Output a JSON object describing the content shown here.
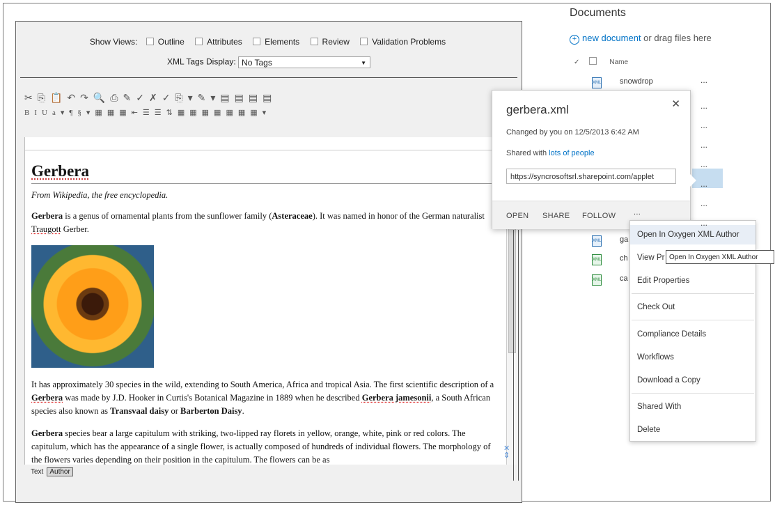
{
  "editor": {
    "show_views_label": "Show Views:",
    "view_options": [
      "Outline",
      "Attributes",
      "Elements",
      "Review",
      "Validation Problems"
    ],
    "xml_tags_label": "XML Tags Display:",
    "xml_tags_value": "No Tags",
    "toolbar_row1": [
      "✂",
      "⎘",
      "📋",
      "↶",
      "↷",
      "🔍",
      "⎙",
      "✎",
      "✓",
      "✗",
      "✓",
      "⎘",
      "▾",
      "✎",
      "▾",
      "▤",
      "▤",
      "▤",
      "▤"
    ],
    "toolbar_row2": [
      "B",
      "I",
      "U",
      "a",
      "▾",
      "¶",
      "§",
      "▾",
      "▦",
      "▦",
      "▦",
      "⇤",
      "☰",
      "☰",
      "⇅",
      "▦",
      "▦",
      "▦",
      "▦",
      "▦",
      "▦",
      "▦",
      "▾"
    ],
    "document": {
      "title": "Gerbera",
      "subtitle": "From Wikipedia, the free encyclopedia.",
      "p1_bold": "Gerbera",
      "p1_a": " is a genus of ornamental plants from the sunflower family (",
      "p1_bold2": "Asteraceae",
      "p1_b": "). It was named in honor of the German naturalist ",
      "p1_name": "Traugott",
      "p1_c": " Gerber.",
      "p2_a": "It has approximately 30 species in the wild, extending to South America, Africa and tropical Asia. The first scientific description of a ",
      "p2_bold": "Gerbera",
      "p2_b": " was made by J.D. Hooker in Curtis's Botanical Magazine in 1889 when he described ",
      "p2_bold2": "Gerbera jamesonii",
      "p2_c": ", a South African species also known as ",
      "p2_bold3": "Transvaal daisy",
      "p2_d": " or ",
      "p2_bold4": "Barberton Daisy",
      "p2_e": ".",
      "p3_bold": "Gerbera",
      "p3_a": " species bear a large capitulum with striking, two-lipped ray florets in yellow, orange, white, pink or red colors. The capitulum, which has the appearance of a single flower, is actually composed of hundreds of individual flowers. The morphology of the flowers varies depending on their position in the capitulum. The flowers can be as"
    },
    "bottom_tabs": [
      "Text",
      "Author"
    ]
  },
  "library": {
    "title": "Documents",
    "new_document_link": "new document",
    "drag_text": " or drag files here",
    "column_name": "Name",
    "check_glyph": "✓",
    "rows": [
      {
        "name": "snowdrop",
        "icon": "xml-file-icon",
        "color": "blue"
      },
      {
        "name": "",
        "icon": "",
        "color": ""
      },
      {
        "name": "",
        "icon": "",
        "color": ""
      },
      {
        "name": "",
        "icon": "",
        "color": ""
      },
      {
        "name": "",
        "icon": "",
        "color": ""
      },
      {
        "name": "",
        "icon": "",
        "color": ""
      },
      {
        "name": "",
        "icon": "",
        "color": ""
      },
      {
        "name": "ga",
        "icon": "xml-file-icon",
        "color": "blue"
      },
      {
        "name": "ch",
        "icon": "xml-file-icon",
        "color": "green"
      },
      {
        "name": "ca",
        "icon": "xml-file-icon",
        "color": "green"
      }
    ],
    "ellipsis": "..."
  },
  "callout": {
    "filename": "gerbera.xml",
    "close_glyph": "✕",
    "changed": "Changed by you on 12/5/2013 6:42 AM",
    "shared_prefix": "Shared with ",
    "shared_link": "lots of people",
    "url": "https://syncrosoftsrl.sharepoint.com/applet",
    "actions": [
      "OPEN",
      "SHARE",
      "FOLLOW",
      "..."
    ]
  },
  "context_menu": {
    "items": [
      "Open In Oxygen XML Author",
      "View Pr",
      "Edit Properties",
      "Check Out",
      "Compliance Details",
      "Workflows",
      "Download a Copy",
      "Shared With",
      "Delete"
    ],
    "tooltip": "Open In Oxygen XML Author"
  },
  "colors": {
    "accent": "#0072c6",
    "selected_row": "#c6ddf0",
    "menu_hover": "#e8eef6"
  }
}
